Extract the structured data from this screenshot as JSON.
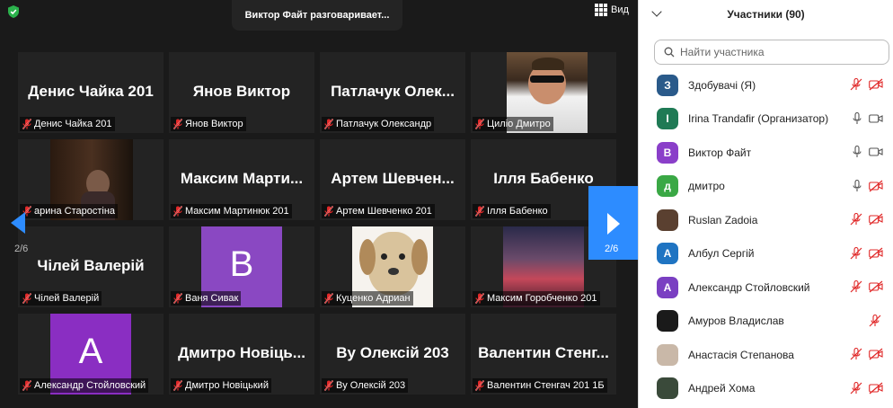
{
  "topbar": {
    "speaking": "Виктор Файт разговаривает...",
    "view_label": "Вид"
  },
  "tiles": [
    {
      "big": "Денис Чайка 201",
      "label": "Денис Чайка 201"
    },
    {
      "big": "Янов Виктор",
      "label": "Янов Виктор"
    },
    {
      "big": "Патлачук  Олек...",
      "label": "Патлачук Олександр"
    },
    {
      "big": "",
      "label": "Циліо Дмитро"
    },
    {
      "big": "",
      "label": "арина Старостіна"
    },
    {
      "big": "Максим  Марти...",
      "label": "Максим Мартинюк 201"
    },
    {
      "big": "Артем  Шевчен...",
      "label": "Артем Шевченко 201"
    },
    {
      "big": "Ілля Бабенко",
      "label": "Ілля Бабенко"
    },
    {
      "big": "Чілей Валерій",
      "label": "Чілей Валерій"
    },
    {
      "big": "B",
      "label": "Ваня Сивак"
    },
    {
      "big": "",
      "label": "Куценко Адриан"
    },
    {
      "big": "",
      "label": "Максим Горобченко 201"
    },
    {
      "big": "A",
      "label": "Александр Стойловский"
    },
    {
      "big": "Дмитро Новіць...",
      "label": "Дмитро Новіцький"
    },
    {
      "big": "Ву Олексій 203",
      "label": "Ву Олексій 203"
    },
    {
      "big": "Валентин  Стенг...",
      "label": "Валентин Стенгач 201 1Б"
    }
  ],
  "pager": {
    "left": "2/6",
    "right": "2/6"
  },
  "panel": {
    "title": "Участники (90)",
    "search_placeholder": "Найти участника",
    "participants": [
      {
        "initial": "З",
        "color": "#2a5a8a",
        "name": "Здобувачі (Я)"
      },
      {
        "initial": "I",
        "color": "#1f7a55",
        "name": "Irina Trandafir (Организатор)"
      },
      {
        "initial": "В",
        "color": "#8a3fc9",
        "name": "Виктор Файт"
      },
      {
        "initial": "д",
        "color": "#3aa845",
        "name": "дмитро"
      },
      {
        "initial": "",
        "color": "#5a4030",
        "name": "Ruslan Zadoia"
      },
      {
        "initial": "А",
        "color": "#1f74c2",
        "name": "Албул Сергій"
      },
      {
        "initial": "А",
        "color": "#7a3fc2",
        "name": "Александр Стойловский"
      },
      {
        "initial": "",
        "color": "#1a1a1a",
        "name": "Амуров Владислав"
      },
      {
        "initial": "",
        "color": "#c9b8a8",
        "name": "Анастасія Степанова"
      },
      {
        "initial": "",
        "color": "#3a4a3a",
        "name": "Андрей Хома"
      }
    ]
  },
  "colors": {
    "accent": "#2d8cff",
    "muted_red": "#e02828",
    "dark_bg": "#1a1a1a"
  }
}
